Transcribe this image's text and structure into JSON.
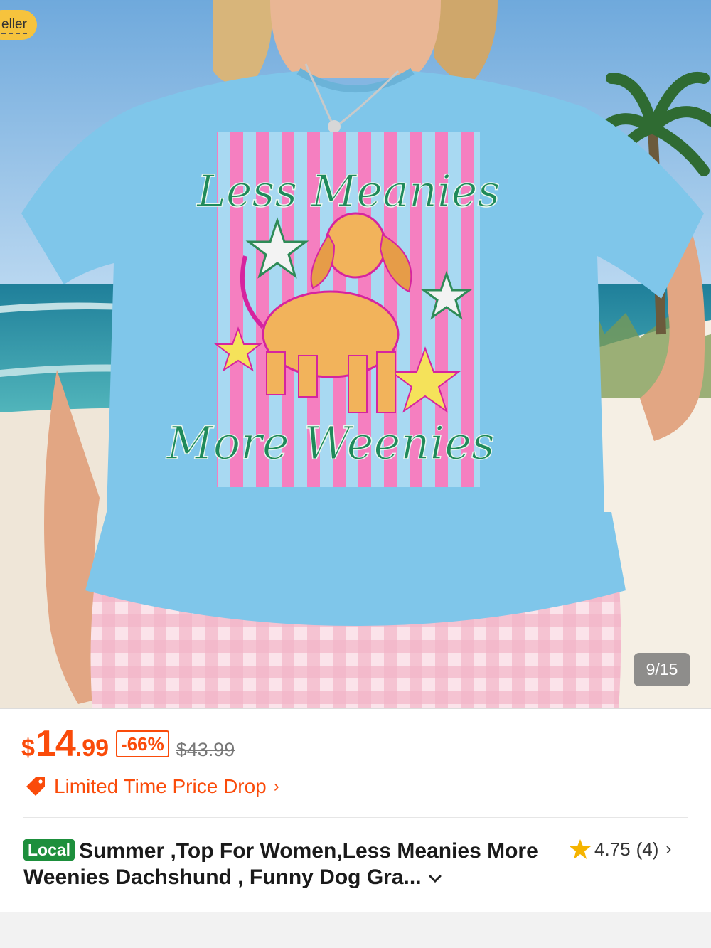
{
  "image": {
    "seller_badge": "eller",
    "counter": "9/15",
    "shirt_print_line1": "Less Meanies",
    "shirt_print_line2": "More Weenies"
  },
  "price": {
    "currency": "$",
    "integer": "14",
    "decimal": ".99",
    "discount": "-66%",
    "original": "$43.99"
  },
  "promo": {
    "label": "Limited Time Price Drop",
    "chevron": "›",
    "icon": "price-tag-icon"
  },
  "product": {
    "local_badge": "Local",
    "title": "Summer ,Top For Women,Less Meanies More Weenies Dachshund , Funny Dog Gra..."
  },
  "rating": {
    "score": "4.75",
    "count": "(4)",
    "chevron": "›"
  },
  "colors": {
    "accent": "#fa4b0a",
    "local_green": "#1d8f3c",
    "star": "#f5b400",
    "shirt": "#7fc6ea"
  }
}
